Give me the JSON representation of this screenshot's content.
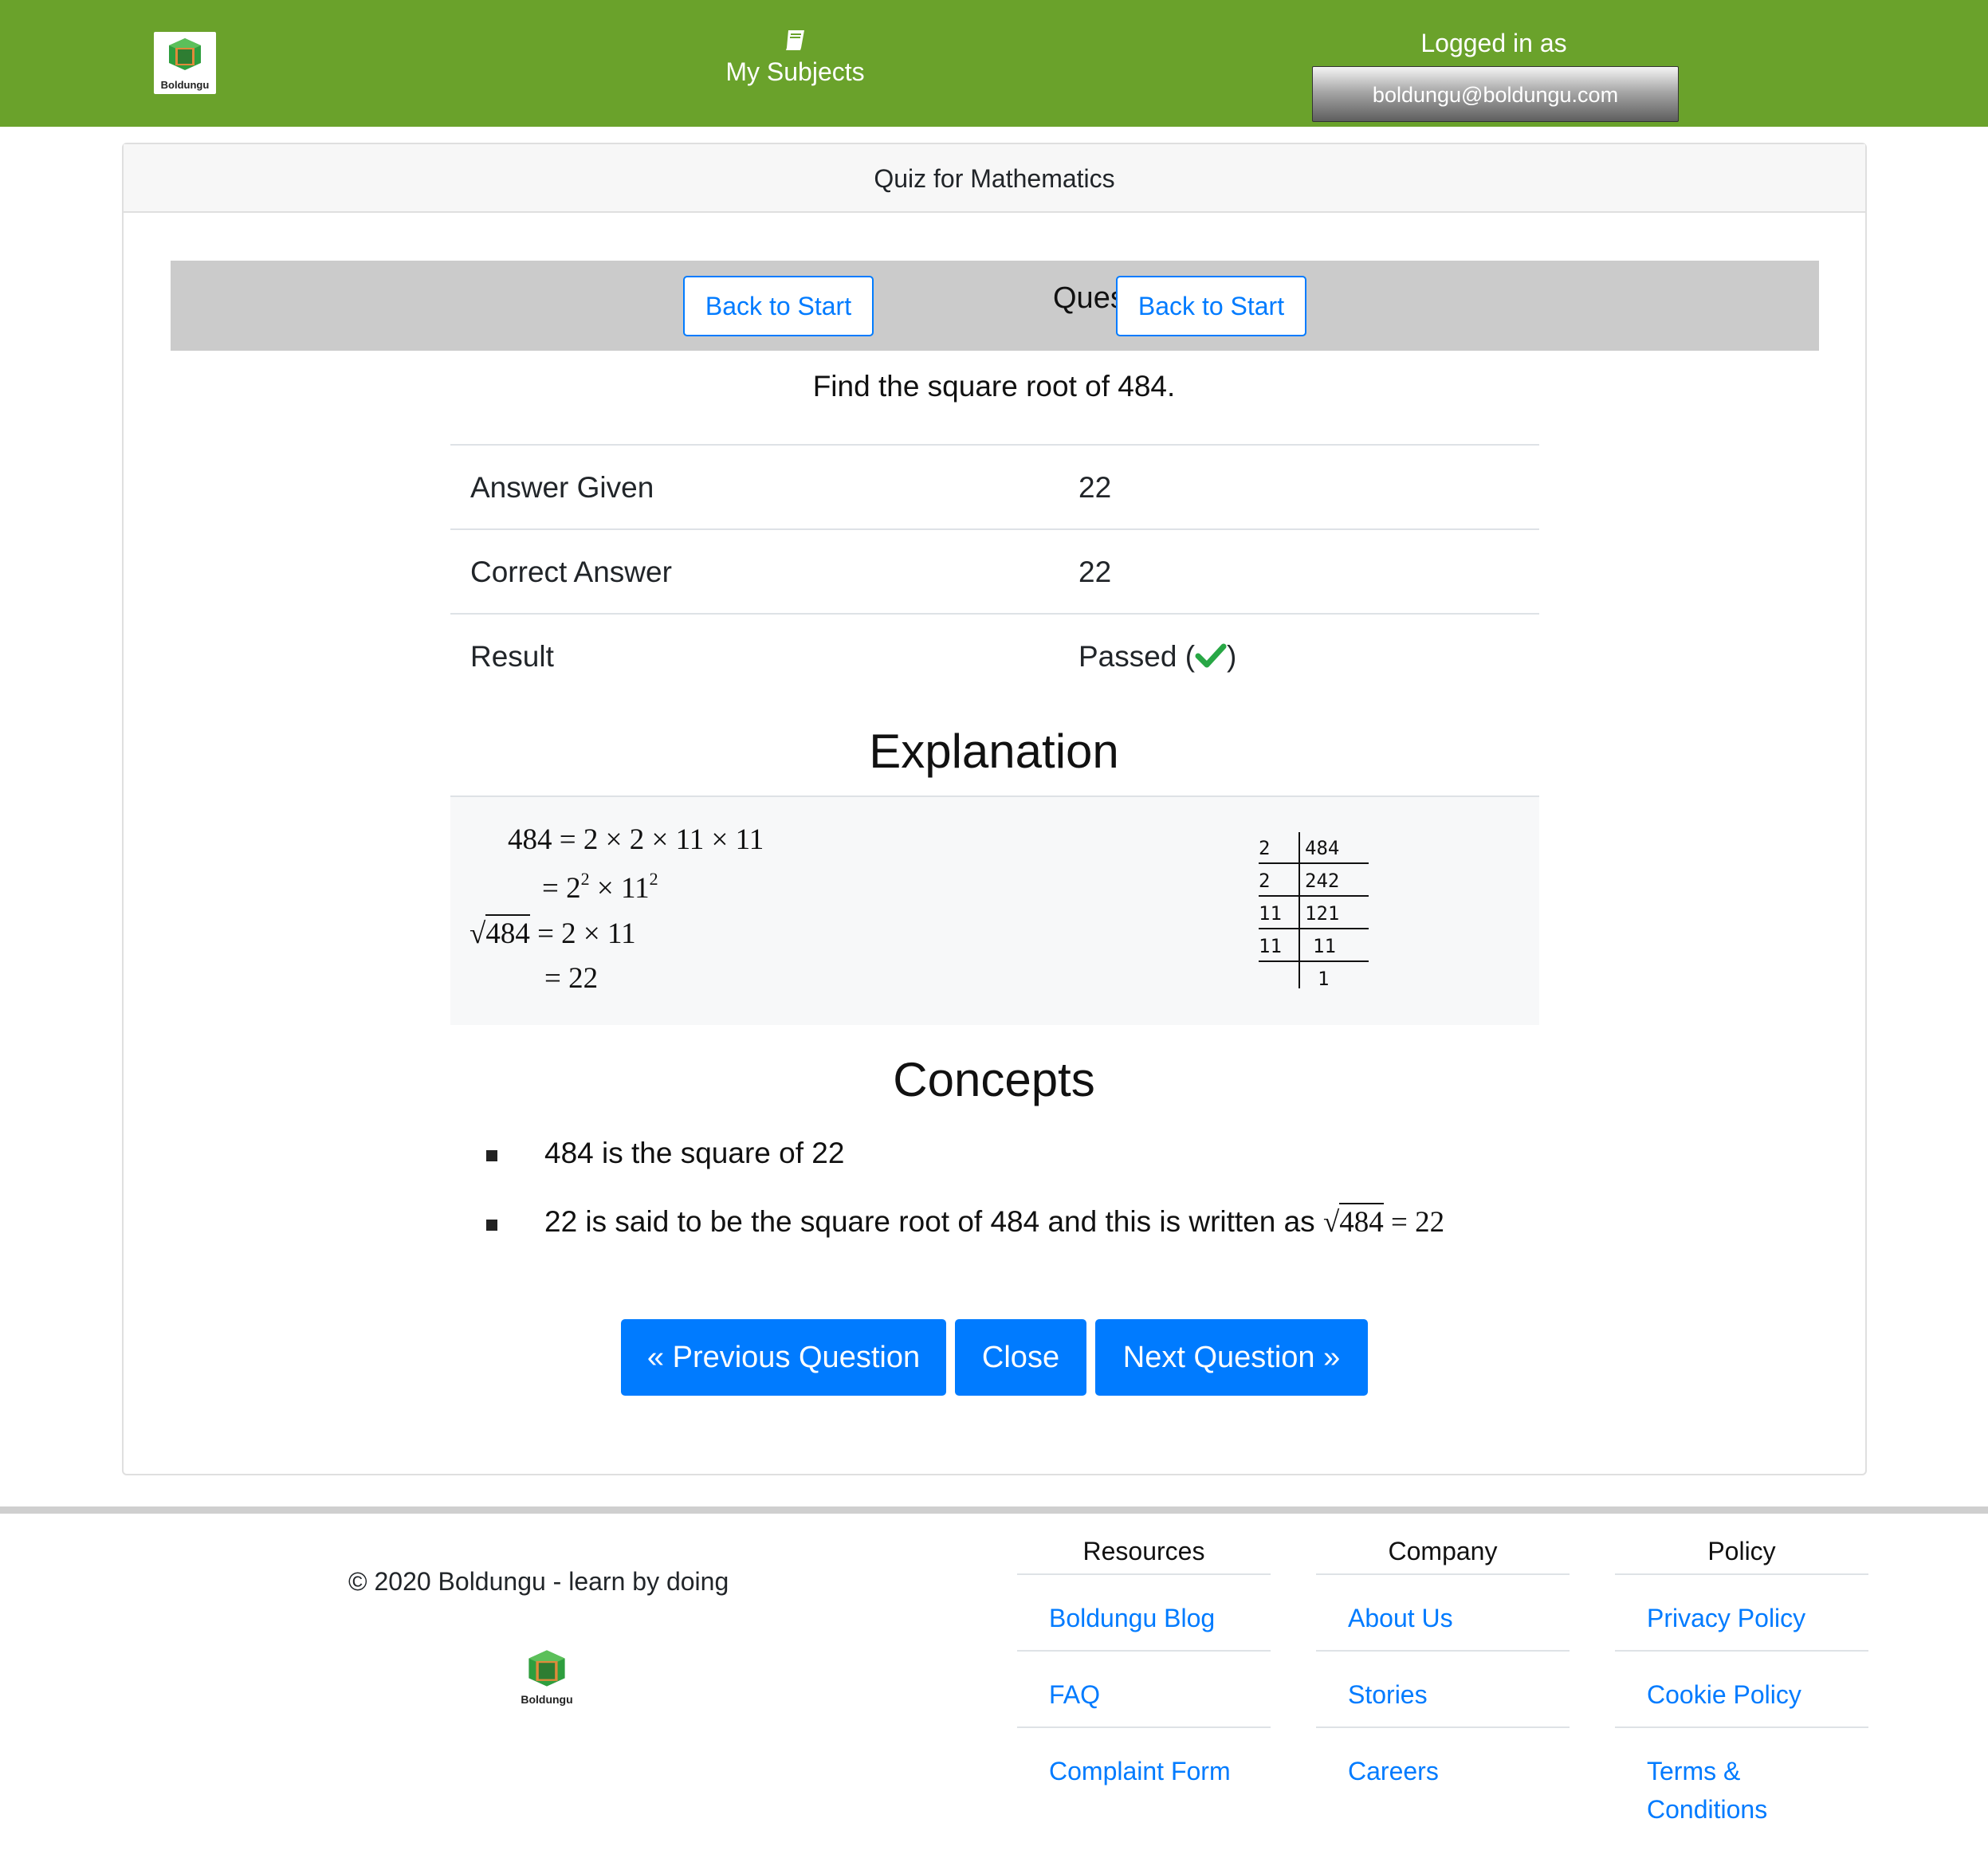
{
  "navbar": {
    "logo_brand": "Boldungu",
    "subjects_label": "My Subjects",
    "logged_in_label": "Logged in as",
    "user_email": "boldungu@boldungu.com"
  },
  "card": {
    "header": "Quiz for Mathematics",
    "back_to_start": "Back to Start",
    "question_counter": "Question 6 of 10",
    "question": "Find the square root of 484."
  },
  "answers": {
    "given_label": "Answer Given",
    "given_value": "22",
    "correct_label": "Correct Answer",
    "correct_value": "22",
    "result_label": "Result",
    "result_value": "Passed",
    "result_open": "(",
    "result_close": ")"
  },
  "explanation": {
    "heading": "Explanation",
    "line1": "484 = 2 × 2 × 11 × 11",
    "line2_eq": "= 2",
    "line2_exp1": "2",
    "line2_mid": " × 11",
    "line2_exp2": "2",
    "line3_radicand": "484",
    "line3_rest": " = 2 × 11",
    "line4": "= 22",
    "division": {
      "divisors": [
        "2",
        "2",
        "11",
        "11",
        ""
      ],
      "quotients": [
        "484",
        "242",
        "121",
        "11",
        "1"
      ]
    }
  },
  "concepts": {
    "heading": "Concepts",
    "item1": "484 is the square of 22",
    "item2_text": "22 is said to be the square root of 484 and this is written as ",
    "item2_radicand": "484",
    "item2_rest": " = 22"
  },
  "nav_buttons": {
    "previous": "« Previous Question",
    "close": "Close",
    "next": "Next Question »"
  },
  "footer": {
    "copyright": "© 2020 Boldungu - learn by doing",
    "logo_brand": "Boldungu",
    "resources": {
      "heading": "Resources",
      "links": [
        "Boldungu Blog",
        "FAQ",
        "Complaint Form"
      ]
    },
    "company": {
      "heading": "Company",
      "links": [
        "About Us",
        "Stories",
        "Careers"
      ]
    },
    "policy": {
      "heading": "Policy",
      "links": [
        "Privacy Policy",
        "Cookie Policy",
        "Terms & Conditions"
      ]
    }
  },
  "colors": {
    "navbar_bg": "#6aa22b",
    "primary": "#007bff",
    "success": "#28a745"
  },
  "icons": {
    "logo": "boldungu-cube-icon",
    "subjects": "book-icon",
    "result": "check-icon"
  }
}
